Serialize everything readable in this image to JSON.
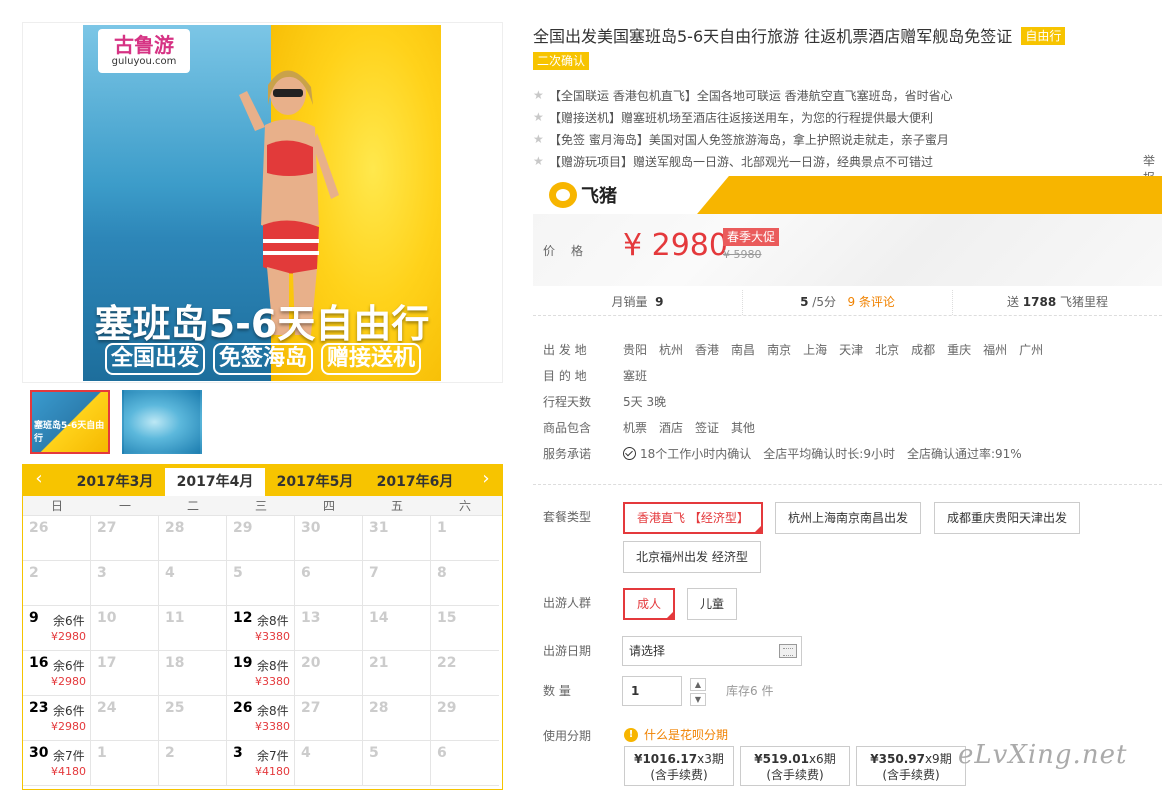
{
  "gallery": {
    "brand_cn": "古鲁游",
    "brand_en": "guluyou.com",
    "banner_title": "塞班岛5-6天自由行",
    "banner_tags": [
      "全国出发",
      "免签海岛",
      "赠接送机"
    ],
    "thumb_caption": "塞班岛5-6天自由行"
  },
  "calendar": {
    "prev_icon": "chevron-left-icon",
    "next_icon": "chevron-right-icon",
    "months": [
      "2017年3月",
      "2017年4月",
      "2017年5月",
      "2017年6月"
    ],
    "active_month_index": 1,
    "weekdays": [
      "日",
      "一",
      "二",
      "三",
      "四",
      "五",
      "六"
    ],
    "cells": [
      {
        "day": "26"
      },
      {
        "day": "27"
      },
      {
        "day": "28"
      },
      {
        "day": "29"
      },
      {
        "day": "30"
      },
      {
        "day": "31"
      },
      {
        "day": "1"
      },
      {
        "day": "2"
      },
      {
        "day": "3"
      },
      {
        "day": "4"
      },
      {
        "day": "5"
      },
      {
        "day": "6"
      },
      {
        "day": "7"
      },
      {
        "day": "8"
      },
      {
        "day": "9",
        "stock": "余6件",
        "price": "¥2980"
      },
      {
        "day": "10"
      },
      {
        "day": "11"
      },
      {
        "day": "12",
        "stock": "余8件",
        "price": "¥3380"
      },
      {
        "day": "13"
      },
      {
        "day": "14"
      },
      {
        "day": "15"
      },
      {
        "day": "16",
        "stock": "余6件",
        "price": "¥2980"
      },
      {
        "day": "17"
      },
      {
        "day": "18"
      },
      {
        "day": "19",
        "stock": "余8件",
        "price": "¥3380"
      },
      {
        "day": "20"
      },
      {
        "day": "21"
      },
      {
        "day": "22"
      },
      {
        "day": "23",
        "stock": "余6件",
        "price": "¥2980"
      },
      {
        "day": "24"
      },
      {
        "day": "25"
      },
      {
        "day": "26",
        "stock": "余8件",
        "price": "¥3380"
      },
      {
        "day": "27"
      },
      {
        "day": "28"
      },
      {
        "day": "29"
      },
      {
        "day": "30",
        "stock": "余7件",
        "price": "¥4180"
      },
      {
        "day": "1"
      },
      {
        "day": "2"
      },
      {
        "day": "3",
        "stock": "余7件",
        "price": "¥4180"
      },
      {
        "day": "4"
      },
      {
        "day": "5"
      },
      {
        "day": "6"
      }
    ]
  },
  "product": {
    "title": "全国出发美国塞班岛5-6天自由行旅游 往返机票酒店赠军舰岛免签证",
    "type_tag": "自由行",
    "confirm_tag": "二次确认",
    "highlights": [
      "【全国联运 香港包机直飞】全国各地可联运 香港航空直飞塞班岛，省时省心",
      "【赠接送机】赠塞班机场至酒店往返接送用车，为您的行程提供最大便利",
      "【免签 蜜月海岛】美国对国人免签旅游海岛，拿上护照说走就走，亲子蜜月",
      "【赠游玩项目】赠送军舰岛一日游、北部观光一日游，经典景点不可错过"
    ],
    "report_link": "举报"
  },
  "price": {
    "platform_name": "飞猪",
    "label": "价格",
    "current": "¥ 2980",
    "promo": "春季大促",
    "original": "¥ 5980"
  },
  "stats": {
    "monthly_sales_label": "月销量",
    "monthly_sales": "9",
    "rating": "5",
    "rating_suffix": "/5分",
    "reviews": "9 条评论",
    "miles_prefix": "送",
    "miles": "1788",
    "miles_suffix": "飞猪里程"
  },
  "details": {
    "departure_label": "出 发 地",
    "departures": [
      "贵阳",
      "杭州",
      "香港",
      "南昌",
      "南京",
      "上海",
      "天津",
      "北京",
      "成都",
      "重庆",
      "福州",
      "广州"
    ],
    "destination_label": "目 的 地",
    "destination": "塞班",
    "days_label": "行程天数",
    "days": "5天 3晚",
    "includes_label": "商品包含",
    "includes": [
      "机票",
      "酒店",
      "签证",
      "其他"
    ],
    "service_label": "服务承诺",
    "service_confirm": "18个工作小时内确认",
    "service_avg": "全店平均确认时长:9小时",
    "service_rate": "全店确认通过率:91%"
  },
  "options": {
    "package_label": "套餐类型",
    "packages": [
      "香港直飞 【经济型】",
      "杭州上海南京南昌出发",
      "成都重庆贵阳天津出发",
      "北京福州出发 经济型"
    ],
    "traveler_label": "出游人群",
    "travelers": [
      "成人",
      "儿童"
    ],
    "date_label": "出游日期",
    "date_placeholder": "请选择",
    "qty_label": "数 量",
    "qty_value": "1",
    "stock": "库存6 件",
    "installment_label": "使用分期",
    "installment_hint": "什么是花呗分期",
    "installments": [
      {
        "amount": "¥1016.17",
        "periods": "x3期",
        "note": "(含手续费)"
      },
      {
        "amount": "¥519.01",
        "periods": "x6期",
        "note": "(含手续费)"
      },
      {
        "amount": "¥350.97",
        "periods": "x9期",
        "note": "(含手续费)"
      }
    ]
  },
  "watermark": "eLvXing.net"
}
